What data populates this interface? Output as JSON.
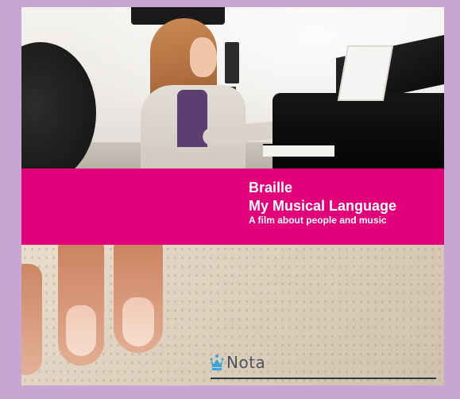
{
  "cover": {
    "title_line1": "Braille",
    "title_line2": "My Musical Language",
    "subtitle": "A film about people and music",
    "band_color": "#e2007a",
    "background_color": "#c7a6d3"
  },
  "brand": {
    "name": "Nota",
    "icon": "crown-icon"
  }
}
